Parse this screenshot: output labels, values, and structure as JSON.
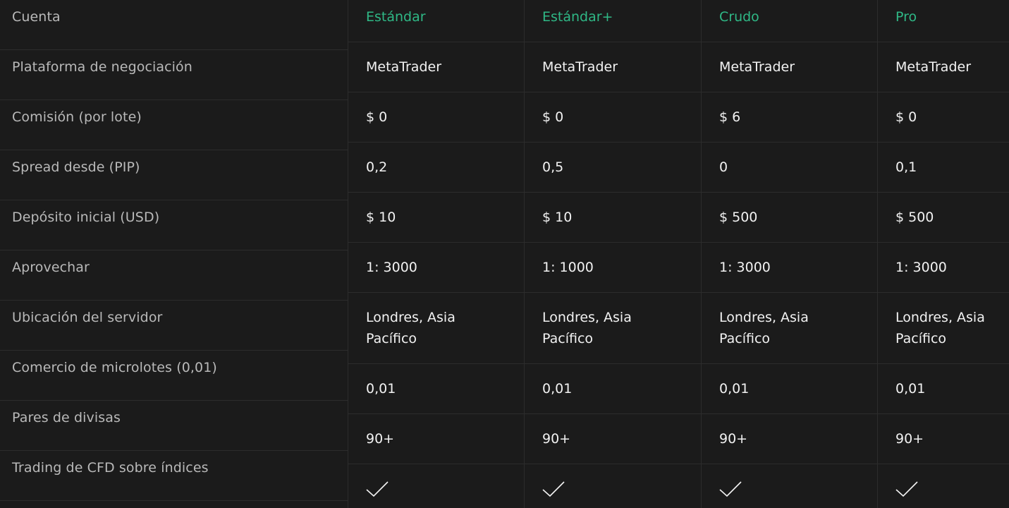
{
  "rows": [
    "Cuenta",
    "Plataforma de negociación",
    "Comisión (por lote)",
    "Spread desde (PIP)",
    "Depósito inicial (USD)",
    "Aprovechar",
    "Ubicación del servidor",
    "Comercio de microlotes (0,01)",
    "Pares de divisas",
    "Trading de CFD sobre índices"
  ],
  "accounts": [
    {
      "name": "Estándar",
      "platform": "MetaTrader",
      "commission": "$ 0",
      "spread": "0,2",
      "deposit": "$ 10",
      "leverage": "1: 3000",
      "server_line1": "Londres, Asia",
      "server_line2": "Pacífico",
      "microlots": "0,01",
      "pairs": "90+",
      "cfd_icon": "checkmark-icon"
    },
    {
      "name": "Estándar+",
      "platform": "MetaTrader",
      "commission": "$ 0",
      "spread": "0,5",
      "deposit": "$ 10",
      "leverage": "1: 1000",
      "server_line1": "Londres, Asia",
      "server_line2": "Pacífico",
      "microlots": "0,01",
      "pairs": "90+",
      "cfd_icon": "checkmark-icon"
    },
    {
      "name": "Crudo",
      "platform": "MetaTrader",
      "commission": "$ 6",
      "spread": "0",
      "deposit": "$ 500",
      "leverage": "1: 3000",
      "server_line1": "Londres, Asia",
      "server_line2": "Pacífico",
      "microlots": "0,01",
      "pairs": "90+",
      "cfd_icon": "checkmark-icon"
    },
    {
      "name": "Pro",
      "platform": "MetaTrader",
      "commission": "$ 0",
      "spread": "0,1",
      "deposit": "$ 500",
      "leverage": "1: 3000",
      "server_line1": "Londres, Asia",
      "server_line2": "Pacífico",
      "microlots": "0,01",
      "pairs": "90+",
      "cfd_icon": "checkmark-icon"
    }
  ],
  "colors": {
    "background": "#1b1b1b",
    "header_accent": "#2fb886",
    "label_text": "#b9b9b9",
    "value_text": "#f2f2f2",
    "grid_line": "#2c2c2c"
  }
}
